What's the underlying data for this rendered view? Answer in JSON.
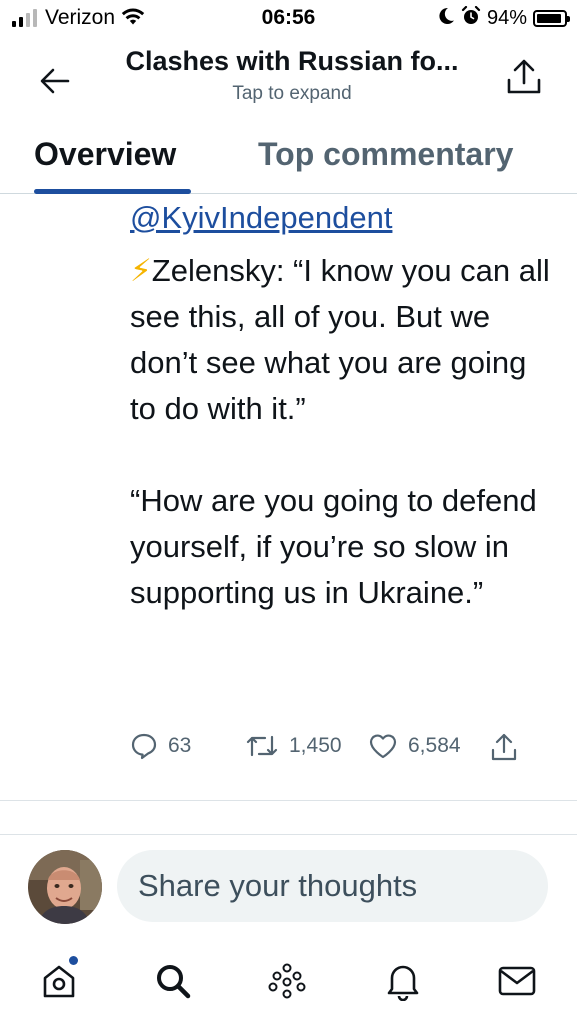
{
  "status_bar": {
    "carrier": "Verizon",
    "time": "06:56",
    "battery": "94%",
    "battery_level": 0.94
  },
  "header": {
    "title": "Clashes with Russian fo...",
    "subtitle": "Tap to expand"
  },
  "tabs": [
    {
      "label": "Overview",
      "active": true
    },
    {
      "label": "Top commentary",
      "active": false
    }
  ],
  "post": {
    "mention": "@KyivIndependent",
    "bolt": "⚡",
    "paragraph1": "Zelensky: “I know you can all see this, all of you. But we don’t see what you are going to do with it.”",
    "paragraph2": "“How are you going to defend yourself, if you’re so slow in supporting us in Ukraine.”",
    "replies": "63",
    "retweets": "1,450",
    "likes": "6,584"
  },
  "compose": {
    "placeholder": "Share your thoughts"
  },
  "colors": {
    "accent": "#1d4e9e",
    "text": "#0f1419",
    "muted": "#536471",
    "input_bg": "#eff3f4"
  },
  "icons": {
    "back": "arrow-left-icon",
    "share": "share-icon",
    "reply": "reply-icon",
    "retweet": "retweet-icon",
    "like": "heart-icon",
    "home": "home-icon",
    "search": "search-icon",
    "spaces": "spaces-icon",
    "notifications": "bell-icon",
    "messages": "mail-icon"
  }
}
